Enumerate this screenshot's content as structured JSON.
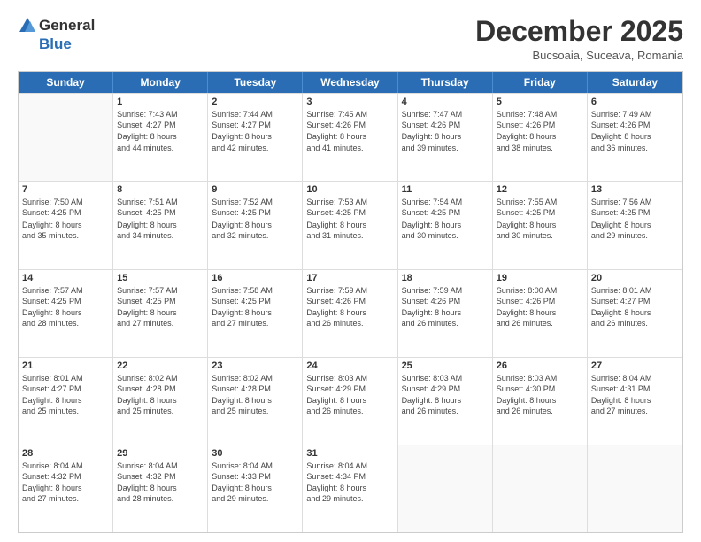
{
  "header": {
    "logo_general": "General",
    "logo_blue": "Blue",
    "month_title": "December 2025",
    "subtitle": "Bucsoaia, Suceava, Romania"
  },
  "weekdays": [
    "Sunday",
    "Monday",
    "Tuesday",
    "Wednesday",
    "Thursday",
    "Friday",
    "Saturday"
  ],
  "rows": [
    [
      {
        "day": "",
        "sunrise": "",
        "sunset": "",
        "daylight": ""
      },
      {
        "day": "1",
        "sunrise": "Sunrise: 7:43 AM",
        "sunset": "Sunset: 4:27 PM",
        "daylight": "Daylight: 8 hours and 44 minutes."
      },
      {
        "day": "2",
        "sunrise": "Sunrise: 7:44 AM",
        "sunset": "Sunset: 4:27 PM",
        "daylight": "Daylight: 8 hours and 42 minutes."
      },
      {
        "day": "3",
        "sunrise": "Sunrise: 7:45 AM",
        "sunset": "Sunset: 4:26 PM",
        "daylight": "Daylight: 8 hours and 41 minutes."
      },
      {
        "day": "4",
        "sunrise": "Sunrise: 7:47 AM",
        "sunset": "Sunset: 4:26 PM",
        "daylight": "Daylight: 8 hours and 39 minutes."
      },
      {
        "day": "5",
        "sunrise": "Sunrise: 7:48 AM",
        "sunset": "Sunset: 4:26 PM",
        "daylight": "Daylight: 8 hours and 38 minutes."
      },
      {
        "day": "6",
        "sunrise": "Sunrise: 7:49 AM",
        "sunset": "Sunset: 4:26 PM",
        "daylight": "Daylight: 8 hours and 36 minutes."
      }
    ],
    [
      {
        "day": "7",
        "sunrise": "Sunrise: 7:50 AM",
        "sunset": "Sunset: 4:25 PM",
        "daylight": "Daylight: 8 hours and 35 minutes."
      },
      {
        "day": "8",
        "sunrise": "Sunrise: 7:51 AM",
        "sunset": "Sunset: 4:25 PM",
        "daylight": "Daylight: 8 hours and 34 minutes."
      },
      {
        "day": "9",
        "sunrise": "Sunrise: 7:52 AM",
        "sunset": "Sunset: 4:25 PM",
        "daylight": "Daylight: 8 hours and 32 minutes."
      },
      {
        "day": "10",
        "sunrise": "Sunrise: 7:53 AM",
        "sunset": "Sunset: 4:25 PM",
        "daylight": "Daylight: 8 hours and 31 minutes."
      },
      {
        "day": "11",
        "sunrise": "Sunrise: 7:54 AM",
        "sunset": "Sunset: 4:25 PM",
        "daylight": "Daylight: 8 hours and 30 minutes."
      },
      {
        "day": "12",
        "sunrise": "Sunrise: 7:55 AM",
        "sunset": "Sunset: 4:25 PM",
        "daylight": "Daylight: 8 hours and 30 minutes."
      },
      {
        "day": "13",
        "sunrise": "Sunrise: 7:56 AM",
        "sunset": "Sunset: 4:25 PM",
        "daylight": "Daylight: 8 hours and 29 minutes."
      }
    ],
    [
      {
        "day": "14",
        "sunrise": "Sunrise: 7:57 AM",
        "sunset": "Sunset: 4:25 PM",
        "daylight": "Daylight: 8 hours and 28 minutes."
      },
      {
        "day": "15",
        "sunrise": "Sunrise: 7:57 AM",
        "sunset": "Sunset: 4:25 PM",
        "daylight": "Daylight: 8 hours and 27 minutes."
      },
      {
        "day": "16",
        "sunrise": "Sunrise: 7:58 AM",
        "sunset": "Sunset: 4:25 PM",
        "daylight": "Daylight: 8 hours and 27 minutes."
      },
      {
        "day": "17",
        "sunrise": "Sunrise: 7:59 AM",
        "sunset": "Sunset: 4:26 PM",
        "daylight": "Daylight: 8 hours and 26 minutes."
      },
      {
        "day": "18",
        "sunrise": "Sunrise: 7:59 AM",
        "sunset": "Sunset: 4:26 PM",
        "daylight": "Daylight: 8 hours and 26 minutes."
      },
      {
        "day": "19",
        "sunrise": "Sunrise: 8:00 AM",
        "sunset": "Sunset: 4:26 PM",
        "daylight": "Daylight: 8 hours and 26 minutes."
      },
      {
        "day": "20",
        "sunrise": "Sunrise: 8:01 AM",
        "sunset": "Sunset: 4:27 PM",
        "daylight": "Daylight: 8 hours and 26 minutes."
      }
    ],
    [
      {
        "day": "21",
        "sunrise": "Sunrise: 8:01 AM",
        "sunset": "Sunset: 4:27 PM",
        "daylight": "Daylight: 8 hours and 25 minutes."
      },
      {
        "day": "22",
        "sunrise": "Sunrise: 8:02 AM",
        "sunset": "Sunset: 4:28 PM",
        "daylight": "Daylight: 8 hours and 25 minutes."
      },
      {
        "day": "23",
        "sunrise": "Sunrise: 8:02 AM",
        "sunset": "Sunset: 4:28 PM",
        "daylight": "Daylight: 8 hours and 25 minutes."
      },
      {
        "day": "24",
        "sunrise": "Sunrise: 8:03 AM",
        "sunset": "Sunset: 4:29 PM",
        "daylight": "Daylight: 8 hours and 26 minutes."
      },
      {
        "day": "25",
        "sunrise": "Sunrise: 8:03 AM",
        "sunset": "Sunset: 4:29 PM",
        "daylight": "Daylight: 8 hours and 26 minutes."
      },
      {
        "day": "26",
        "sunrise": "Sunrise: 8:03 AM",
        "sunset": "Sunset: 4:30 PM",
        "daylight": "Daylight: 8 hours and 26 minutes."
      },
      {
        "day": "27",
        "sunrise": "Sunrise: 8:04 AM",
        "sunset": "Sunset: 4:31 PM",
        "daylight": "Daylight: 8 hours and 27 minutes."
      }
    ],
    [
      {
        "day": "28",
        "sunrise": "Sunrise: 8:04 AM",
        "sunset": "Sunset: 4:32 PM",
        "daylight": "Daylight: 8 hours and 27 minutes."
      },
      {
        "day": "29",
        "sunrise": "Sunrise: 8:04 AM",
        "sunset": "Sunset: 4:32 PM",
        "daylight": "Daylight: 8 hours and 28 minutes."
      },
      {
        "day": "30",
        "sunrise": "Sunrise: 8:04 AM",
        "sunset": "Sunset: 4:33 PM",
        "daylight": "Daylight: 8 hours and 29 minutes."
      },
      {
        "day": "31",
        "sunrise": "Sunrise: 8:04 AM",
        "sunset": "Sunset: 4:34 PM",
        "daylight": "Daylight: 8 hours and 29 minutes."
      },
      {
        "day": "",
        "sunrise": "",
        "sunset": "",
        "daylight": ""
      },
      {
        "day": "",
        "sunrise": "",
        "sunset": "",
        "daylight": ""
      },
      {
        "day": "",
        "sunrise": "",
        "sunset": "",
        "daylight": ""
      }
    ]
  ]
}
